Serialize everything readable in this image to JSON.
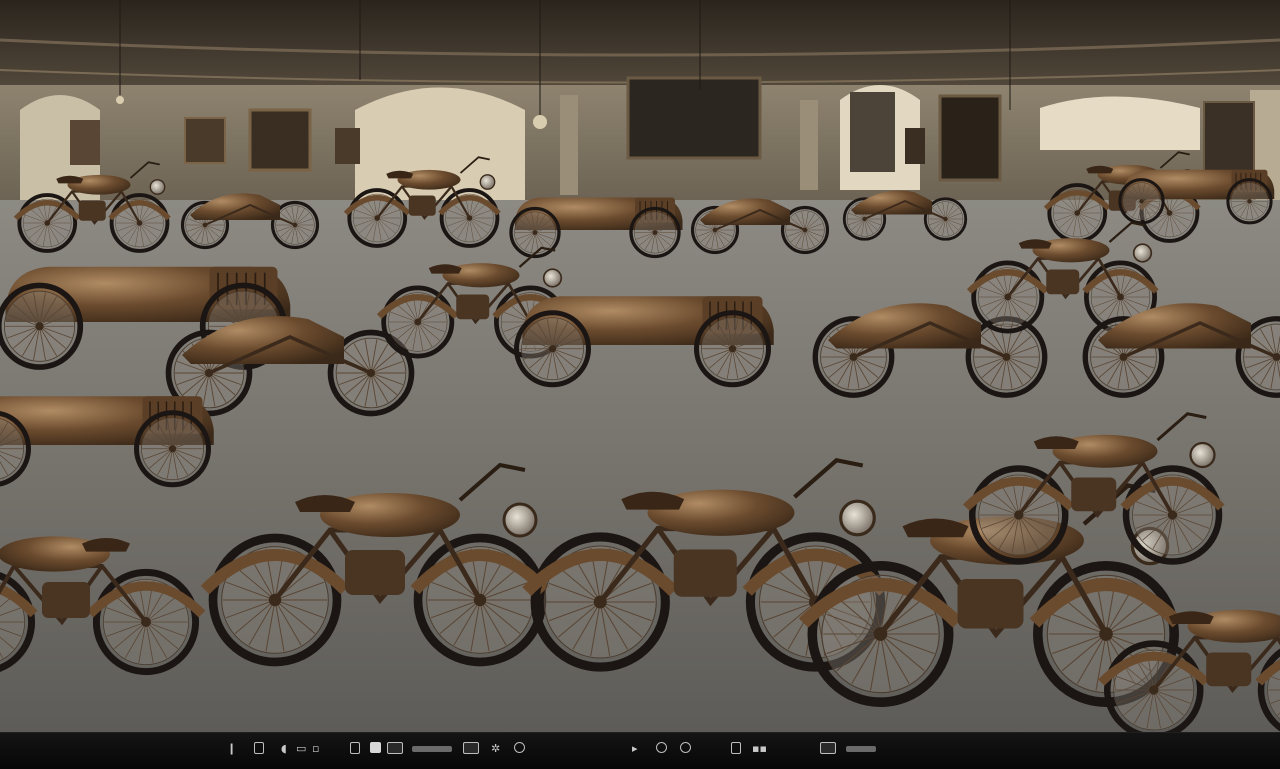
{
  "scene": {
    "subject": "vintage-motorcycle-museum-hall",
    "palette": {
      "ceiling": "#3b332a",
      "wall": "#a59a86",
      "floor": "#6f6d68",
      "floor_far": "#8b8882",
      "bronze": "#6b4b2e",
      "bronze_light": "#a9865f",
      "tire": "#1b1613",
      "spoke": "#5a4634"
    }
  },
  "taskbar": {
    "icons": [
      "pin-icon",
      "page-icon",
      "chat-icon",
      "folder-icon",
      "file-icon",
      "camera-icon",
      "app-icon",
      "window-icon",
      "strip-icon",
      "mail-icon",
      "gear-icon",
      "settings-icon",
      "play-icon",
      "clock-icon",
      "grid-icon",
      "window-icon",
      "control-icon",
      "notification-icon"
    ]
  }
}
